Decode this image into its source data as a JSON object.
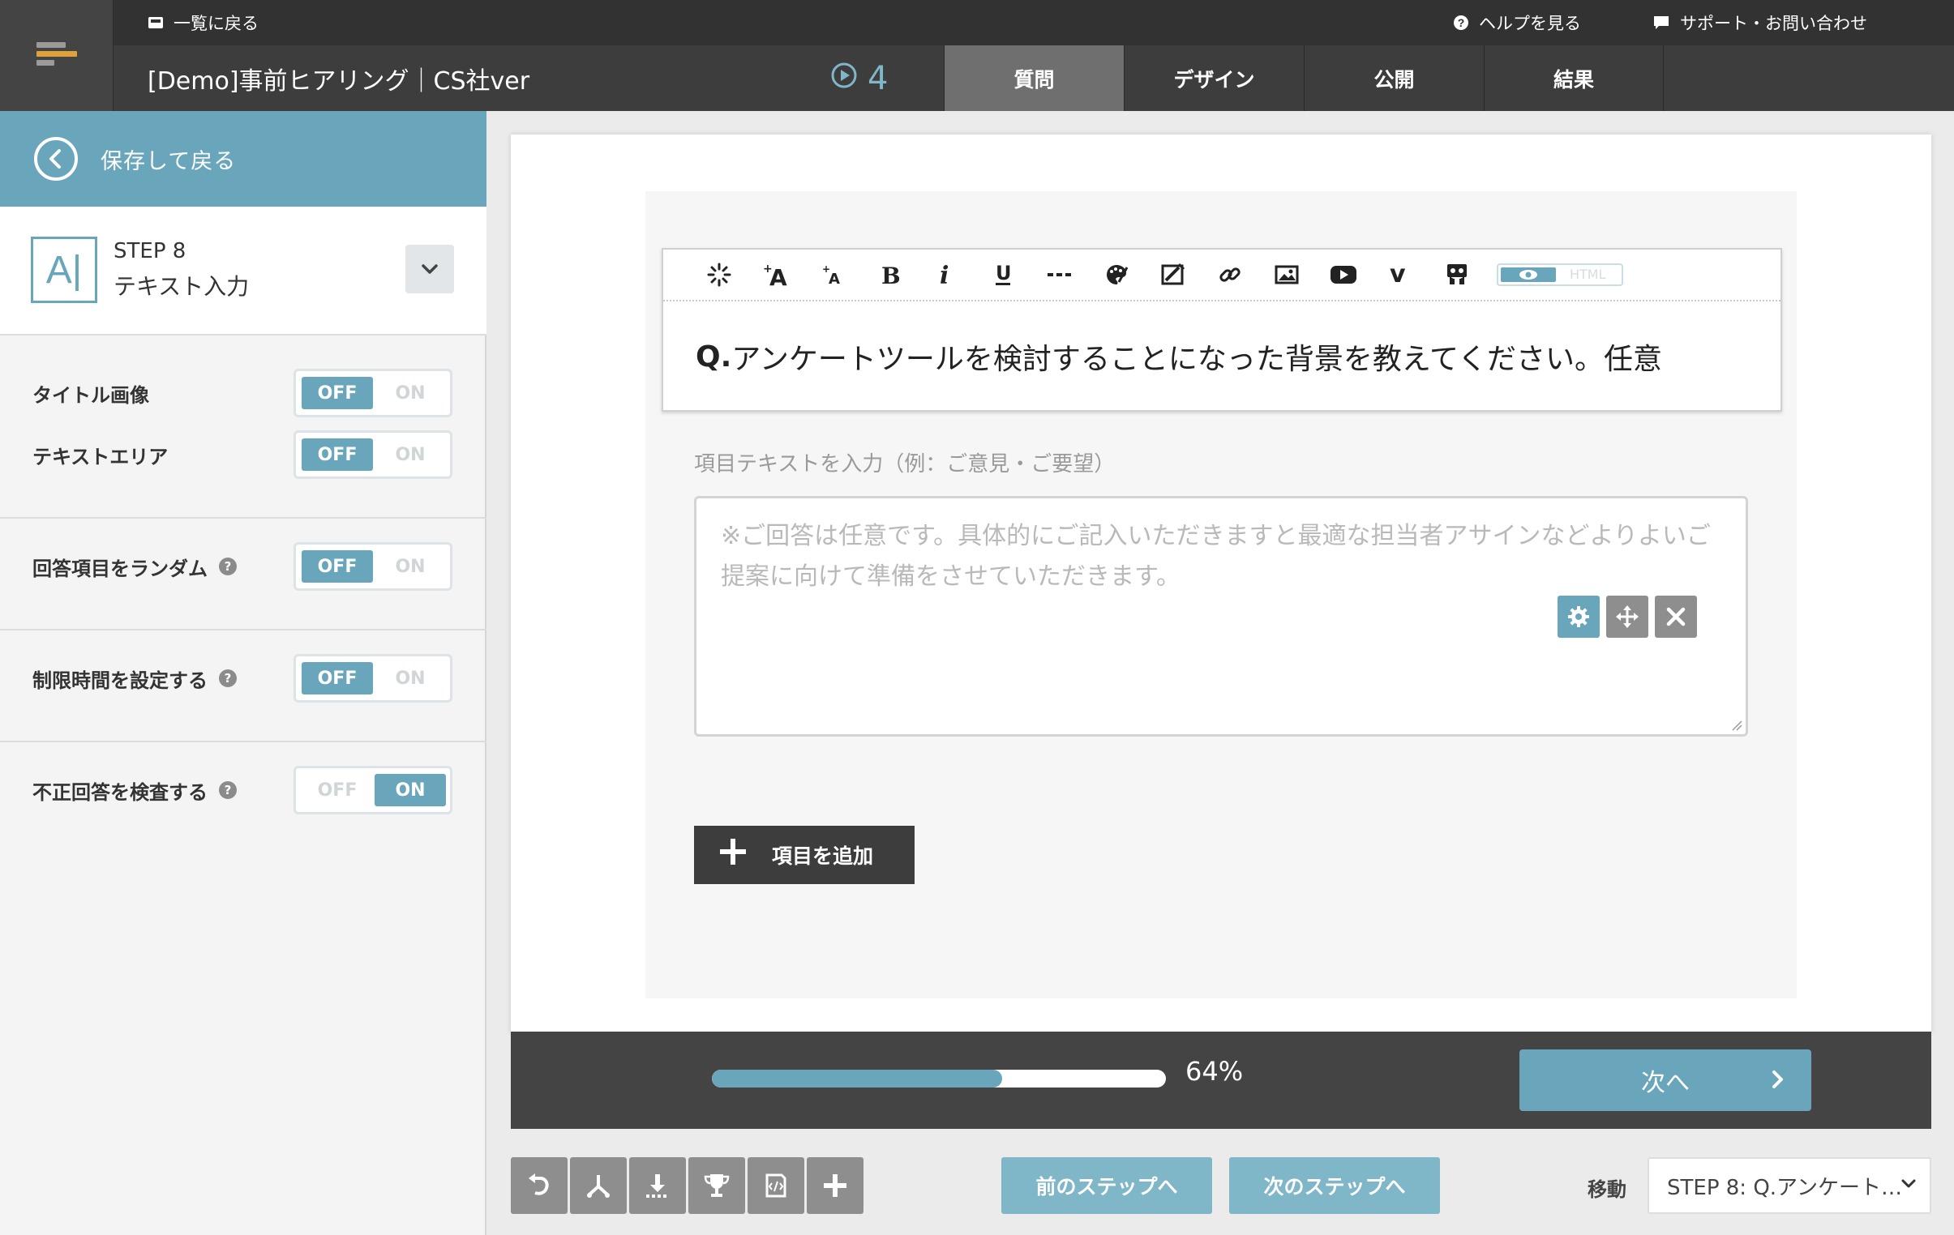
{
  "header": {
    "back_to_list": "一覧に戻る",
    "help": "ヘルプを見る",
    "support": "サポート・お問い合わせ",
    "survey_title": "[Demo]事前ヒアリング｜CS社ver",
    "step_count": "4",
    "tabs": [
      {
        "label": "質問",
        "active": true
      },
      {
        "label": "デザイン",
        "active": false
      },
      {
        "label": "公開",
        "active": false
      },
      {
        "label": "結果",
        "active": false
      }
    ]
  },
  "sidebar": {
    "save_back": "保存して戻る",
    "step_icon": "A|",
    "step_number": "STEP 8",
    "step_type": "テキスト入力",
    "options": [
      {
        "label": "タイトル画像",
        "value": "OFF",
        "help": false
      },
      {
        "label": "テキストエリア",
        "value": "OFF",
        "help": false
      },
      {
        "label": "回答項目をランダム",
        "value": "OFF",
        "help": true
      },
      {
        "label": "制限時間を設定する",
        "value": "OFF",
        "help": true
      },
      {
        "label": "不正回答を検査する",
        "value": "ON",
        "help": true
      }
    ],
    "off_label": "OFF",
    "on_label": "ON",
    "help_mark": "?"
  },
  "editor": {
    "toolbar_html_label": "HTML",
    "question_prefix": "Q.",
    "question_text": "アンケートツールを検討することになった背景を教えてください。任意",
    "item_hint": "項目テキストを入力（例：ご意見・ご要望）",
    "answer_placeholder": "※ご回答は任意です。具体的にご記入いただきますと最適な担当者アサインなどよりよいご提案に向けて準備をさせていただきます。",
    "add_item": "項目を追加"
  },
  "footer": {
    "progress_percent": 64,
    "progress_label": "64%",
    "next": "次へ"
  },
  "bottom": {
    "prev_step": "前のステップへ",
    "next_step": "次のステップへ",
    "move_label": "移動",
    "step_select": "STEP 8: Q.アンケート…"
  },
  "colors": {
    "accent": "#6aa6bb",
    "header_dark": "#3a3a3a",
    "logo_orange": "#e0a03a"
  },
  "icons": {
    "toolbar": [
      "magic-icon",
      "font-size-up-icon",
      "font-size-down-icon",
      "bold-icon",
      "italic-icon",
      "underline-icon",
      "hr-icon",
      "palette-icon",
      "clear-format-icon",
      "link-icon",
      "image-icon",
      "youtube-icon",
      "vimeo-icon",
      "slideshare-icon"
    ],
    "bottom_tools": [
      "undo-icon",
      "branch-icon",
      "download-icon",
      "trophy-icon",
      "template-icon",
      "plus-icon"
    ]
  }
}
